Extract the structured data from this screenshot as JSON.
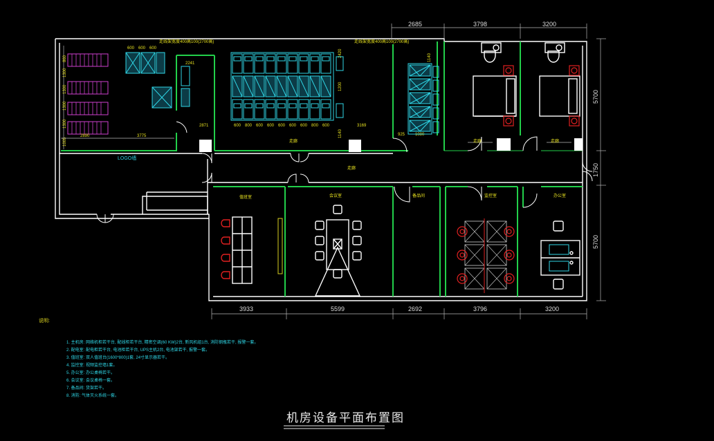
{
  "drawing": {
    "title": "机房设备平面布置图",
    "notes_heading": "说明:",
    "logo_label": "LOGO墙",
    "colors": {
      "wall": "#ffffff",
      "partition": "#22d04a",
      "equipment": "#2fd6e6",
      "furniture_red": "#e02020",
      "battery": "#d040d0",
      "text": "#dcdcdc"
    }
  },
  "dimensions": {
    "top": [
      "2685",
      "3798",
      "3200"
    ],
    "bottom": [
      "3933",
      "5599",
      "2692",
      "3796",
      "3200"
    ],
    "right": [
      "5700",
      "1750",
      "5700"
    ],
    "interior": {
      "d2241": "2241",
      "d2871": "2871",
      "d2890": "2890",
      "d3775": "3775",
      "d3169": "3169",
      "d925": "925",
      "d1080": "1080",
      "d1140": "1140",
      "d1200": "1200",
      "d2420": "2420",
      "d600": "600",
      "d800": "800"
    },
    "rack_widths": [
      "600",
      "800",
      "600",
      "600",
      "600",
      "600",
      "600",
      "800",
      "600"
    ],
    "ac_widths": [
      "600",
      "600",
      "600"
    ],
    "left_stack": [
      "1005",
      "1300",
      "1300",
      "1300",
      "1300",
      "860"
    ]
  },
  "room_labels": {
    "main_machine_room_tray": "走线架宽度400高100(2700高)",
    "power_room_tray": "走线架宽度400高100(2700高)",
    "duty_room": "值班室",
    "meeting_room": "会议室",
    "storage": "备品间",
    "monitor_room": "监控室",
    "office": "办公室",
    "corridor": "走廊"
  },
  "notes": [
    "1. 主机房: 网络机柜若干台, 配线柜若干台, 精密空调(60 KW)2台, 新风机组1台, 消防钢瓶若干, 报警一套。",
    "2. 配电室: 配电柜若干台, 电池柜若干台, UPS主机2台, 电池架若干, 报警一套。",
    "3. 值班室: 双人值班台(1600*800)1套, 24寸显示器若干。",
    "4. 监控室: 视频监控墙1套。",
    "5. 办公室: 办公桌椅若干。",
    "6. 会议室: 会议桌椅一套。",
    "7. 备品间: 货架若干。",
    "8. 消防: 气体灭火系统一套。"
  ]
}
